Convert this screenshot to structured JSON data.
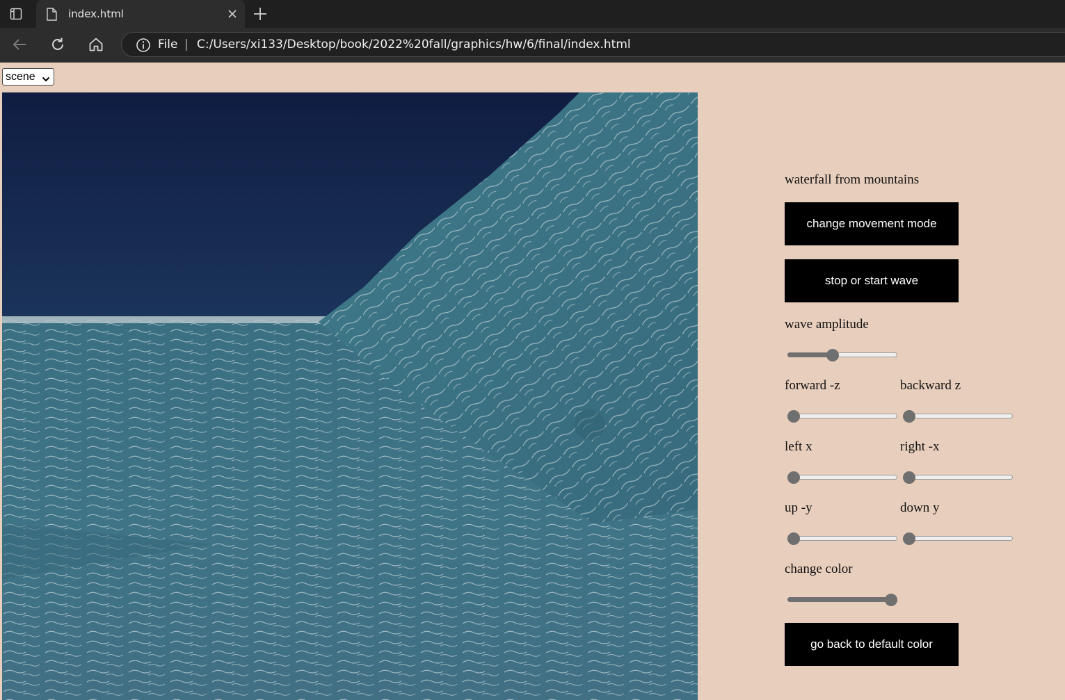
{
  "browser": {
    "tab_title": "index.html",
    "address_scheme": "File",
    "address_separator": "|",
    "url": "C:/Users/xi133/Desktop/book/2022%20fall/graphics/hw/6/final/index.html"
  },
  "page": {
    "scene_select": {
      "value": "scene"
    },
    "canvas_description": "waterfall from mountains",
    "buttons": {
      "movement": "change movement mode",
      "wave": "stop or start wave",
      "default_color": "go back to default color"
    },
    "sliders": {
      "amplitude": {
        "label": "wave amplitude",
        "value": 0.4
      },
      "forward": {
        "label": "forward -z",
        "value": 0.0
      },
      "backward": {
        "label": "backward z",
        "value": 0.0
      },
      "left": {
        "label": "left x",
        "value": 0.0
      },
      "right": {
        "label": "right -x",
        "value": 0.0
      },
      "up": {
        "label": "up -y",
        "value": 0.0
      },
      "down": {
        "label": "down y",
        "value": 0.0
      },
      "color": {
        "label": "change color",
        "value": 1.0
      }
    }
  },
  "colors": {
    "page_bg": "#e8cebd",
    "sky_top": "#121f44",
    "sky_horizon": "#6d8aa0",
    "water": "#3e7282"
  },
  "icons": [
    "tab-actions-icon",
    "page-icon",
    "close-icon",
    "plus-icon",
    "back-arrow-icon",
    "reload-icon",
    "home-icon",
    "info-icon",
    "chevron-down-icon"
  ]
}
